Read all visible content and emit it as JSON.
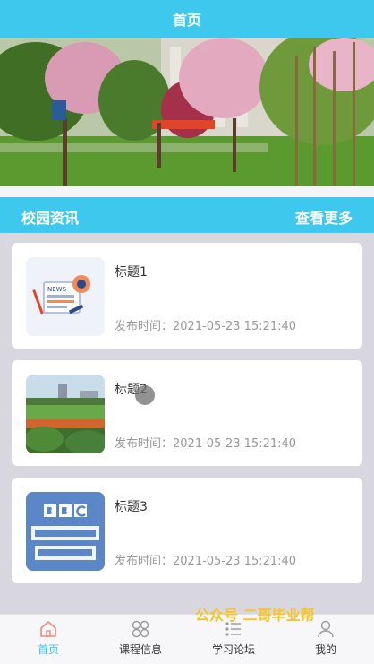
{
  "header": {
    "title": "首页"
  },
  "banner": {
    "slide_count": 3,
    "active_slide": 1,
    "dot_active_color": "#3fc8ee"
  },
  "section": {
    "title": "校园资讯",
    "more": "查看更多"
  },
  "news": [
    {
      "title": "标题1",
      "time": "发布时间：2021-05-23 15:21:40",
      "thumb_icon": "news-illustration-icon"
    },
    {
      "title": "标题2",
      "time": "发布时间：2021-05-23 15:21:40",
      "thumb_icon": "campus-field-photo"
    },
    {
      "title": "标题3",
      "time": "发布时间：2021-05-23 15:21:40",
      "thumb_icon": "bbc-world-news-logo"
    }
  ],
  "tabs": [
    {
      "label": "首页",
      "icon": "home-icon",
      "active": true
    },
    {
      "label": "课程信息",
      "icon": "course-icon",
      "active": false
    },
    {
      "label": "学习论坛",
      "icon": "forum-icon",
      "active": false
    },
    {
      "label": "我的",
      "icon": "user-icon",
      "active": false
    }
  ],
  "watermark": "公众号 二哥毕业帮",
  "colors": {
    "accent": "#3fc8ee",
    "background": "#d8d7e0"
  }
}
